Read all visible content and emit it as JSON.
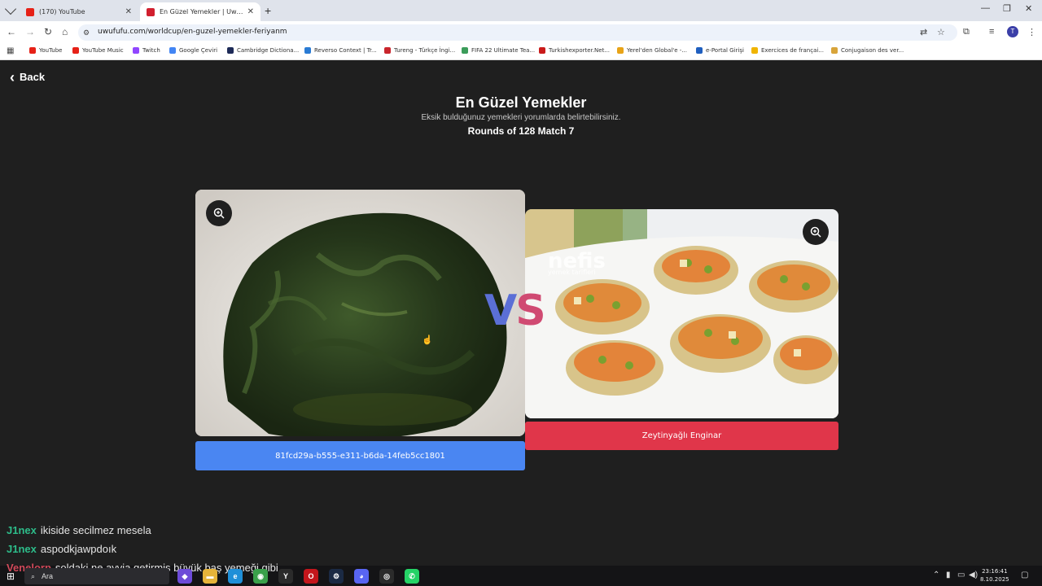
{
  "browser": {
    "tabs": [
      {
        "title": "(170) YouTube",
        "active": false,
        "color": "#e62117"
      },
      {
        "title": "En Güzel Yemekler | UwUFUFU",
        "active": true,
        "color": "#d11f2e"
      }
    ],
    "url": "uwufufu.com/worldcup/en-guzel-yemekler-feriyanm",
    "profile_initial": "T",
    "bookmarks": [
      {
        "label": "YouTube",
        "color": "#e62117"
      },
      {
        "label": "YouTube Music",
        "color": "#e62117"
      },
      {
        "label": "Twitch",
        "color": "#9146ff"
      },
      {
        "label": "Google Çeviri",
        "color": "#4285f4"
      },
      {
        "label": "Cambridge Dictiona...",
        "color": "#1d2a57"
      },
      {
        "label": "Reverso Context | Tr...",
        "color": "#2a7bd4"
      },
      {
        "label": "Tureng - Türkçe İngi...",
        "color": "#c9252c"
      },
      {
        "label": "FIFA 22 Ultimate Tea...",
        "color": "#3b9c5a"
      },
      {
        "label": "Turkishexporter.Net...",
        "color": "#c91a1a"
      },
      {
        "label": "Yerel'den Global'e -...",
        "color": "#e8a317"
      },
      {
        "label": "e-Portal Girişi",
        "color": "#1f5fbf"
      },
      {
        "label": "Exercices de françai...",
        "color": "#f0b400"
      },
      {
        "label": "Conjugaison des ver...",
        "color": "#d8a43a"
      }
    ]
  },
  "page": {
    "back_label": "Back",
    "title": "En Güzel Yemekler",
    "description": "Eksik bulduğunuz yemekleri yorumlarda belirtebilirsiniz.",
    "round_info": "Rounds of 128 Match 7",
    "vs_v": "V",
    "vs_s": "S",
    "left_choice": "81fcd29a-b555-e311-b6da-14feb5cc1801",
    "right_choice": "Zeytinyağlı Enginar",
    "watermark_brand": "nefis",
    "watermark_sub": "yemek tarifleri"
  },
  "chat": [
    {
      "user": "J1nex",
      "message": "ikiside secilmez mesela"
    },
    {
      "user": "J1nex",
      "message": "aspodkjawpdoık"
    },
    {
      "user": "Venelorp",
      "message": "soldaki ne ayvia getirmiş büyük baş yemeği gibi"
    }
  ],
  "taskbar": {
    "search_placeholder": "Ara",
    "time": "23:16:41",
    "date": "8.10.2025"
  }
}
